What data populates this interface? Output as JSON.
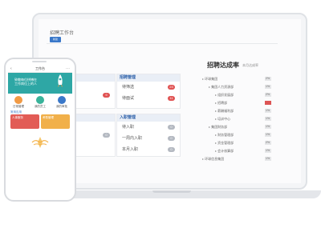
{
  "laptop": {
    "window_title": "招聘工作台",
    "action_button": "新建",
    "left_section_title": "",
    "middle_panel_top": {
      "title": "招聘管理",
      "rows": [
        {
          "label": "待筛选",
          "badge": "23"
        },
        {
          "label": "待面试",
          "badge": "11"
        }
      ]
    },
    "left_panel_top": {
      "rows": [
        {
          "label": "",
          "badge": "9"
        }
      ]
    },
    "middle_panel_bottom": {
      "title": "入职管理",
      "rows": [
        {
          "label": "待入职",
          "badge": "0"
        },
        {
          "label": "一周内入职",
          "badge": "0"
        },
        {
          "label": "本月入职",
          "badge": "0"
        }
      ]
    },
    "left_panel_bottom": {
      "rows": [
        {
          "label": "",
          "badge": "0"
        }
      ]
    },
    "tree": {
      "title": "招聘达成率",
      "subtitle": "本月达成率",
      "items": [
        {
          "label": "环球集团",
          "value": "2%",
          "hot": false,
          "indent": 0
        },
        {
          "label": "集团人力资源部",
          "value": "1%",
          "hot": false,
          "indent": 1
        },
        {
          "label": "组织发展部",
          "value": "2%",
          "hot": false,
          "indent": 2
        },
        {
          "label": "招聘部",
          "value": "",
          "hot": true,
          "indent": 2
        },
        {
          "label": "薪酬福利部",
          "value": "1%",
          "hot": false,
          "indent": 2
        },
        {
          "label": "培训中心",
          "value": "1%",
          "hot": false,
          "indent": 2
        },
        {
          "label": "集团财务部",
          "value": "1%",
          "hot": false,
          "indent": 1
        },
        {
          "label": "财务管理部",
          "value": "1%",
          "hot": false,
          "indent": 2
        },
        {
          "label": "资金管理部",
          "value": "2%",
          "hot": false,
          "indent": 2
        },
        {
          "label": "会计核算部",
          "value": "1%",
          "hot": false,
          "indent": 2
        },
        {
          "label": "环球信息集团",
          "value": "1%",
          "hot": false,
          "indent": 0
        }
      ]
    }
  },
  "phone": {
    "nav_title": "工作台",
    "banner_text": "致敬每位拼搏在工作岗位上的人",
    "icons": [
      {
        "label": "日常管理",
        "color": "#f19a44"
      },
      {
        "label": "我的员工",
        "color": "#39b39a"
      },
      {
        "label": "我的审批",
        "color": "#3a78c9"
      }
    ],
    "section_label": "常用应用",
    "cards": [
      {
        "label": "人事服务",
        "color": "#e25c56"
      },
      {
        "label": "考勤管理",
        "color": "#f1b04a"
      }
    ]
  }
}
